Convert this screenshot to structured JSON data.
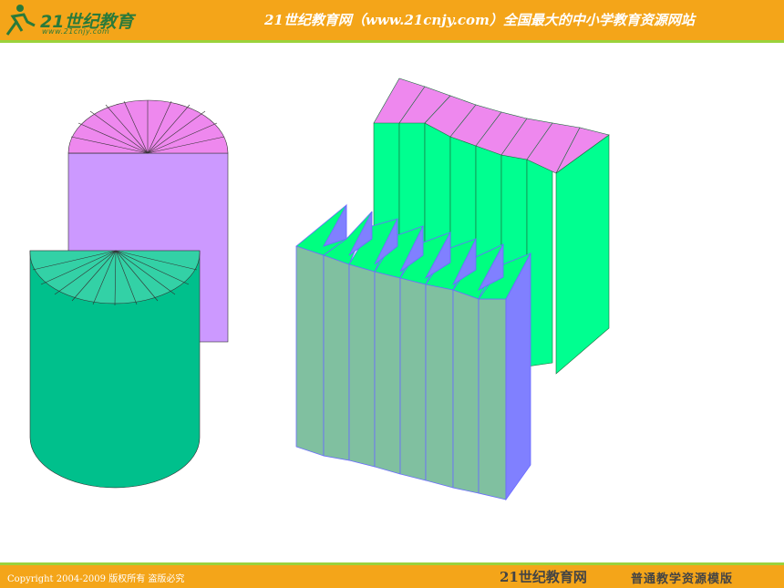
{
  "header": {
    "logo_text": "21世纪教育",
    "logo_subtext": "www.21cnjy.com",
    "title": "21世纪教育网（www.21cnjy.com）全国最大的中小学教育资源网站",
    "logo_icon": "runner-icon"
  },
  "footer": {
    "copyright": "Copyright 2004-2009 版权所有 盗版必究",
    "site_name": "21世纪教育网",
    "template_label": "普通教学资源模版"
  },
  "diagram": {
    "description_shapes": [
      "purple-cylinder-cut",
      "teal-cylinder-cut",
      "green-wedge-row",
      "teal-wedge-row"
    ],
    "colors": {
      "pink": "#ee88ee",
      "lavender": "#cc99ff",
      "teal": "#00c08c",
      "teal_light": "#33d1a6",
      "green": "#00ff80",
      "sage": "#80c0a0",
      "violet": "#8080ff",
      "mint": "#00ff90",
      "orange": "#f4a519",
      "lime": "#9bd23c"
    }
  }
}
